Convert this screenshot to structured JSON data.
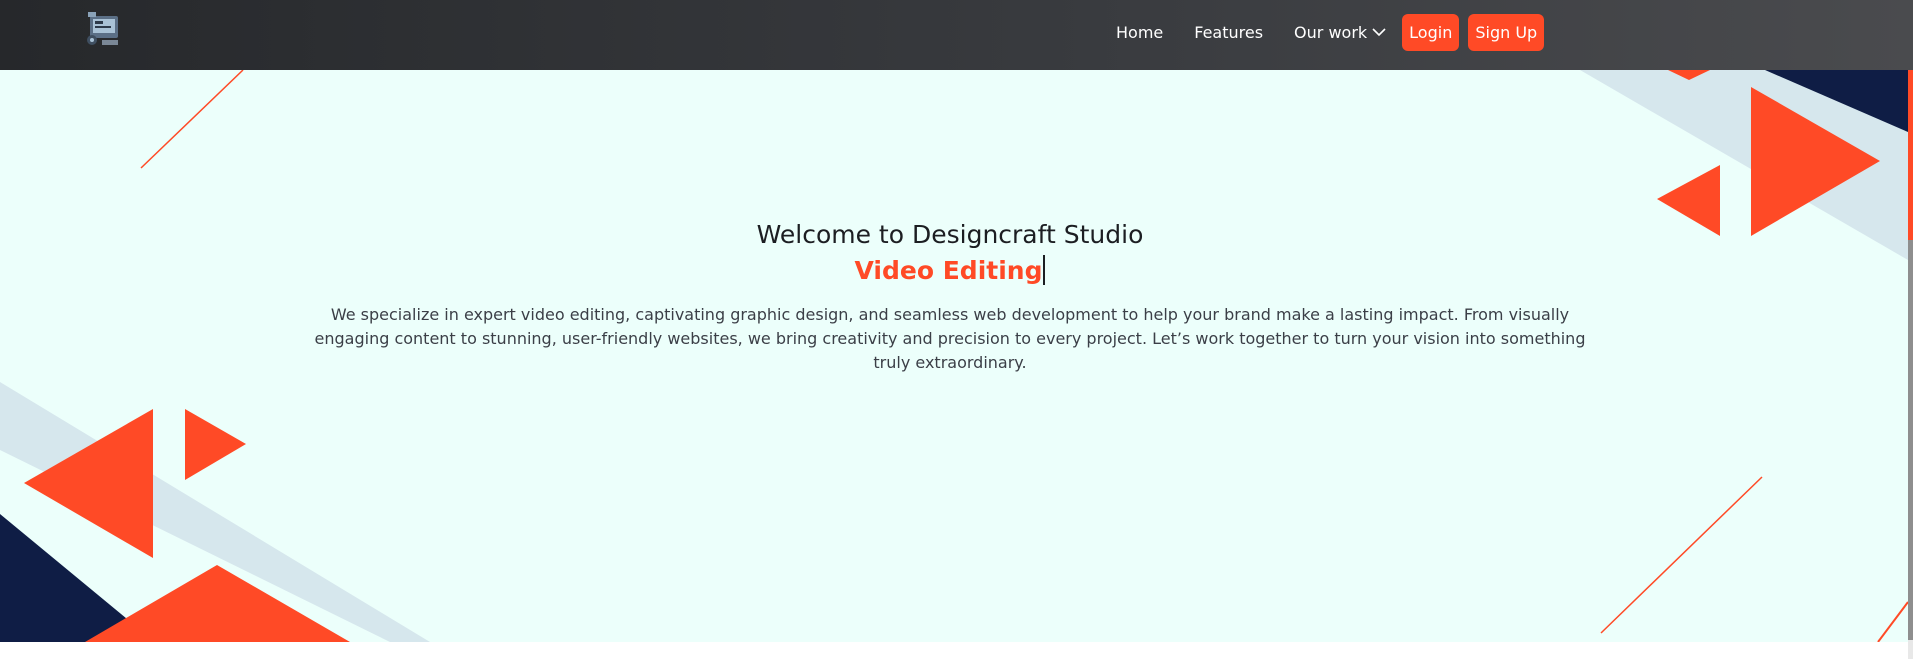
{
  "nav": {
    "logo_icon": "video-editing-logo-icon",
    "links": [
      {
        "label": "Home"
      },
      {
        "label": "Features"
      },
      {
        "label": "Our work"
      }
    ],
    "login_label": "Login",
    "signup_label": "Sign Up"
  },
  "hero": {
    "title": "Welcome to Designcraft Studio",
    "typed_text": "Video Editing",
    "description": "We specialize in expert video editing, captivating graphic design, and seamless web development to help your brand make a lasting impact. From visually engaging content to stunning, user-friendly websites, we bring creativity and precision to every project. Let’s work together to turn your vision into something truly extraordinary."
  },
  "colors": {
    "accent": "#ff4a26",
    "hero_background": "#ecfffb",
    "navy": "#0f1d45",
    "stripe": "#d6e7ed",
    "navbar": "#2b2d30"
  }
}
